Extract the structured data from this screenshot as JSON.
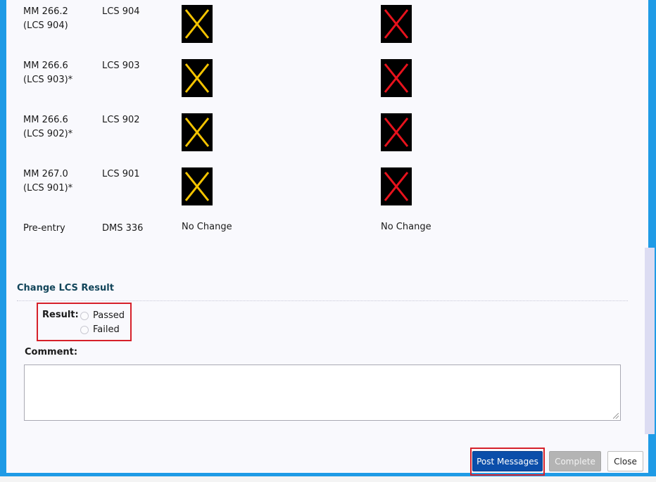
{
  "rows": [
    {
      "location": "MM 266.2\n(LCS 904)",
      "device": "LCS 904",
      "current": "yellow-x-sign",
      "new": "red-x-sign"
    },
    {
      "location": "MM 266.6\n(LCS 903)*",
      "device": "LCS 903",
      "current": "yellow-x-sign",
      "new": "red-x-sign"
    },
    {
      "location": "MM 266.6\n(LCS 902)*",
      "device": "LCS 902",
      "current": "yellow-x-sign",
      "new": "red-x-sign"
    },
    {
      "location": "MM 267.0\n(LCS 901)*",
      "device": "LCS 901",
      "current": "yellow-x-sign",
      "new": "red-x-sign"
    },
    {
      "location": "Pre-entry",
      "device": "DMS 336",
      "current_text": "No Change",
      "new_text": "No Change"
    }
  ],
  "colors": {
    "yellow_x": "#f5c400",
    "red_x": "#e8121c",
    "accent": "#0b4eaa",
    "highlight": "#d6202a"
  },
  "section": {
    "title": "Change LCS Result"
  },
  "result": {
    "label": "Result:",
    "options": [
      "Passed",
      "Failed"
    ],
    "selected": null
  },
  "comment": {
    "label": "Comment:",
    "value": ""
  },
  "buttons": {
    "post": "Post Messages",
    "complete": "Complete",
    "close": "Close"
  }
}
